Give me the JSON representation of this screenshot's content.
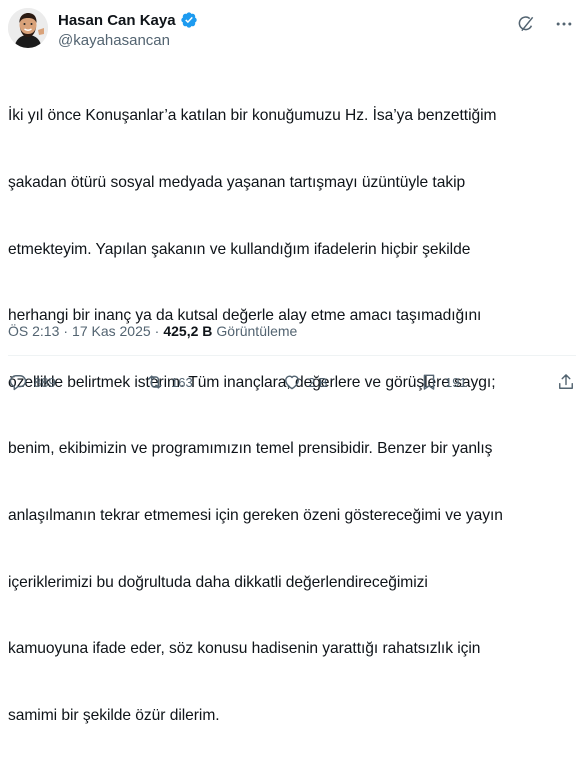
{
  "author": {
    "display_name": "Hasan Can Kaya",
    "handle": "@kayahasancan",
    "verified": true,
    "verified_color": "#1d9bf0"
  },
  "tweet": {
    "lines": [
      "İki yıl önce Konuşanlar’a katılan bir konuğumuzu Hz. İsa’ya benzettiğim",
      "şakadan ötürü sosyal medyada yaşanan tartışmayı üzüntüyle takip",
      "etmekteyim. Yapılan şakanın ve kullandığım ifadelerin hiçbir şekilde",
      "herhangi bir inanç ya da kutsal değerle alay etme amacı taşımadığını",
      "özellikle belirtmek isterim. Tüm inançlara, değerlere ve görüşlere saygı;",
      "benim, ekibimizin ve programımızın temel prensibidir. Benzer bir yanlış",
      "anlaşılmanın tekrar etmemesi için gereken özeni göstereceğimi ve yayın",
      "içeriklerimizi bu doğrultuda daha dikkatli değerlendireceğimizi",
      "kamuoyuna ifade eder, söz konusu hadisenin yarattığı rahatsızlık için",
      "samimi bir şekilde özür dilerim."
    ]
  },
  "meta": {
    "time": "ÖS 2:13",
    "separator": "·",
    "date": "17 Kas 2025",
    "views_count": "425,2 B",
    "views_label": "Görüntüleme"
  },
  "actions": {
    "replies": "889",
    "reposts": "163",
    "likes": "2 B",
    "bookmarks": "191"
  },
  "icons": {
    "top": [
      "grok-icon",
      "more-icon"
    ],
    "bar": [
      "reply-icon",
      "repost-icon",
      "like-icon",
      "bookmark-icon",
      "share-icon"
    ]
  },
  "colors": {
    "text": "#0f1419",
    "secondary": "#536471",
    "divider": "#eff3f4"
  }
}
